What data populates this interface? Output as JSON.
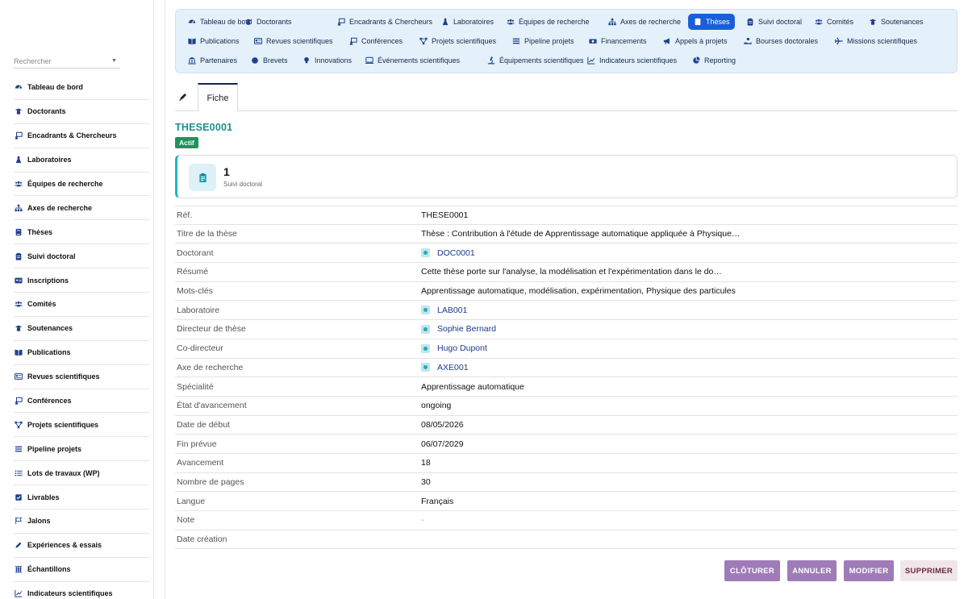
{
  "sidebar": {
    "search_placeholder": "Rechercher",
    "items": [
      {
        "label": "Tableau de bord",
        "icon": "dashboard-icon"
      },
      {
        "label": "Doctorants",
        "icon": "graduate-icon"
      },
      {
        "label": "Encadrants & Chercheurs",
        "icon": "teacher-icon"
      },
      {
        "label": "Laboratoires",
        "icon": "flask-icon"
      },
      {
        "label": "Équipes de recherche",
        "icon": "users-icon"
      },
      {
        "label": "Axes de recherche",
        "icon": "sitemap-icon"
      },
      {
        "label": "Thèses",
        "icon": "book-icon"
      },
      {
        "label": "Suivi doctoral",
        "icon": "clipboard-icon"
      },
      {
        "label": "Inscriptions",
        "icon": "id-card-icon"
      },
      {
        "label": "Comités",
        "icon": "users-icon"
      },
      {
        "label": "Soutenances",
        "icon": "graduate-icon"
      },
      {
        "label": "Publications",
        "icon": "open-book-icon"
      },
      {
        "label": "Revues scientifiques",
        "icon": "newspaper-icon"
      },
      {
        "label": "Conférences",
        "icon": "teacher-icon"
      },
      {
        "label": "Projets scientifiques",
        "icon": "diagram-icon"
      },
      {
        "label": "Pipeline projets",
        "icon": "bars-icon"
      },
      {
        "label": "Lots de travaux (WP)",
        "icon": "list-icon"
      },
      {
        "label": "Livrables",
        "icon": "checkbox-icon"
      },
      {
        "label": "Jalons",
        "icon": "flag-icon"
      },
      {
        "label": "Expériences & essais",
        "icon": "pen-icon"
      },
      {
        "label": "Échantillons",
        "icon": "vials-icon"
      },
      {
        "label": "Indicateurs scientifiques",
        "icon": "chart-icon"
      }
    ]
  },
  "topnav": {
    "active": "Thèses",
    "rows": [
      [
        {
          "label": "Tableau de bord",
          "icon": "dashboard-icon"
        },
        {
          "label": "Doctorants",
          "icon": "graduate-icon"
        },
        {
          "label": "Encadrants & Chercheurs",
          "icon": "teacher-icon"
        },
        {
          "label": "Laboratoires",
          "icon": "flask-icon"
        },
        {
          "label": "Équipes de recherche",
          "icon": "users-icon"
        },
        {
          "label": "Axes de recherche",
          "icon": "sitemap-icon"
        },
        {
          "label": "Thèses",
          "icon": "book-icon"
        },
        {
          "label": "Suivi doctoral",
          "icon": "clipboard-icon"
        },
        {
          "label": "Comités",
          "icon": "users-icon"
        },
        {
          "label": "Soutenances",
          "icon": "graduate-icon"
        }
      ],
      [
        {
          "label": "Publications",
          "icon": "open-book-icon"
        },
        {
          "label": "Revues scientifiques",
          "icon": "newspaper-icon"
        },
        {
          "label": "Conférences",
          "icon": "teacher-icon"
        },
        {
          "label": "Projets scientifiques",
          "icon": "diagram-icon"
        },
        {
          "label": "Pipeline projets",
          "icon": "bars-icon"
        },
        {
          "label": "Financements",
          "icon": "money-icon"
        },
        {
          "label": "Appels à projets",
          "icon": "megaphone-icon"
        },
        {
          "label": "Bourses doctorales",
          "icon": "hand-coin-icon"
        },
        {
          "label": "Missions scientifiques",
          "icon": "plane-icon"
        }
      ],
      [
        {
          "label": "Partenaires",
          "icon": "building-icon"
        },
        {
          "label": "Brevets",
          "icon": "certificate-icon"
        },
        {
          "label": "Innovations",
          "icon": "bulb-icon"
        },
        {
          "label": "Événements scientifiques",
          "icon": "screen-icon"
        },
        {
          "label": "Équipements scientifiques",
          "icon": "microscope-icon"
        },
        {
          "label": "Indicateurs scientifiques",
          "icon": "chart-icon"
        },
        {
          "label": "Reporting",
          "icon": "pie-icon"
        }
      ]
    ]
  },
  "tabs": {
    "edit_icon": "edit-icon",
    "fiche": "Fiche"
  },
  "record": {
    "title": "THESE0001",
    "status": "Actif",
    "stat": {
      "value": "1",
      "label": "Suivi doctoral",
      "icon": "clipboard-icon"
    },
    "fields": [
      {
        "key": "Réf.",
        "value": "THESE0001"
      },
      {
        "key": "Titre de la thèse",
        "value": "Thèse : Contribution à l'étude de Apprentissage automatique appliquée à Physique…"
      },
      {
        "key": "Doctorant",
        "value": "DOC0001",
        "link": true
      },
      {
        "key": "Résumé",
        "value": "Cette thèse porte sur l'analyse, la modélisation et l'expérimentation dans le do…"
      },
      {
        "key": "Mots-clés",
        "value": "Apprentissage automatique, modélisation, expérimentation, Physique des particules"
      },
      {
        "key": "Laboratoire",
        "value": "LAB001",
        "link": true
      },
      {
        "key": "Directeur de thèse",
        "value": "Sophie Bernard",
        "link": true
      },
      {
        "key": "Co-directeur",
        "value": "Hugo Dupont",
        "link": true
      },
      {
        "key": "Axe de recherche",
        "value": "AXE001",
        "link": true
      },
      {
        "key": "Spécialité",
        "value": "Apprentissage automatique"
      },
      {
        "key": "État d'avancement",
        "value": "ongoing"
      },
      {
        "key": "Date de début",
        "value": "08/05/2026"
      },
      {
        "key": "Fin prévue",
        "value": "06/07/2029"
      },
      {
        "key": "Avancement",
        "value": "18"
      },
      {
        "key": "Nombre de pages",
        "value": "30"
      },
      {
        "key": "Langue",
        "value": "Français"
      },
      {
        "key": "Note",
        "value": "-",
        "empty": true
      },
      {
        "key": "Date création",
        "value": ""
      }
    ]
  },
  "actions": {
    "close": "CLÔTURER",
    "cancel": "ANNULER",
    "edit": "MODIFIER",
    "delete": "SUPPRIMER"
  },
  "colors": {
    "accent": "#1a5fd8",
    "teal": "#1b8f8f",
    "badge": "#22925e",
    "action": "#9f7bb7",
    "nav_bg": "#e4f1fb"
  }
}
